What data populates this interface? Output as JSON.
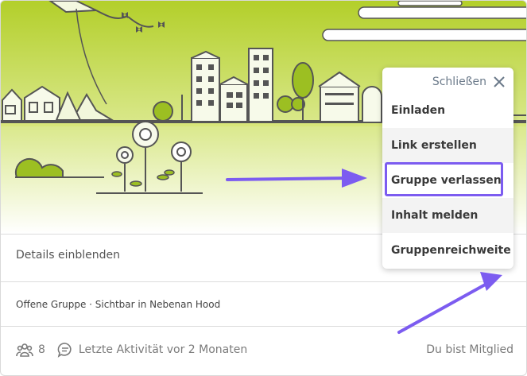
{
  "details_label": "Details einblenden",
  "group_meta": "Offene Gruppe · Sichtbar in Nebenan Hood",
  "footer": {
    "member_count": "8",
    "activity": "Letzte Aktivität vor 2 Monaten",
    "membership": "Du bist Mitglied"
  },
  "menu": {
    "close_label": "Schließen",
    "items": [
      {
        "label": "Einladen"
      },
      {
        "label": "Link erstellen"
      },
      {
        "label": "Gruppe verlassen"
      },
      {
        "label": "Inhalt melden"
      },
      {
        "label": "Gruppenreichweite"
      }
    ]
  },
  "colors": {
    "hero_green": "#b7d334",
    "accent_purple": "#7c5cf0",
    "text_gray": "#555555"
  },
  "icons": {
    "members": "members-icon",
    "comment": "comment-icon",
    "close": "close-icon"
  }
}
